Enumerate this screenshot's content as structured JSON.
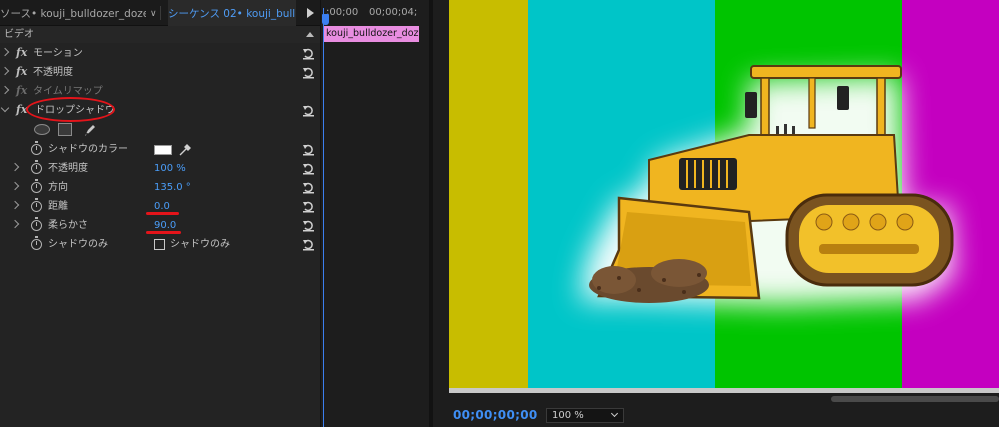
{
  "tabs": {
    "source": "ソース• kouji_bulldozer_doze...",
    "sequence": "シーケンス 02• kouji_bull..."
  },
  "section": {
    "label": "ビデオ"
  },
  "effects": {
    "motion": "モーション",
    "opacity": "不透明度",
    "time_remap": "タイムリマップ",
    "drop_shadow": "ドロップシャドウ"
  },
  "drop_shadow": {
    "shadow_color_label": "シャドウのカラー",
    "shadow_color": "#FFFFFF",
    "opacity_label": "不透明度",
    "opacity_value": "100 %",
    "direction_label": "方向",
    "direction_value": "135.0 °",
    "distance_label": "距離",
    "distance_value": "0.0",
    "softness_label": "柔らかさ",
    "softness_value": "90.0",
    "shadow_only_label": "シャドウのみ",
    "shadow_only_checkbox_label": "シャドウのみ",
    "shadow_only_checked": false
  },
  "timeline": {
    "tc_start": ";00;00",
    "tc_end": "00;00;04;",
    "clip_name": "kouji_bulldozer_doz"
  },
  "monitor": {
    "timecode": "00;00;00;00",
    "zoom": "100 %",
    "color_bars": [
      "#c8bd00",
      "#00c5c8",
      "#00c400",
      "#c400c0"
    ]
  },
  "annotations": {
    "color": "#E4141A"
  }
}
